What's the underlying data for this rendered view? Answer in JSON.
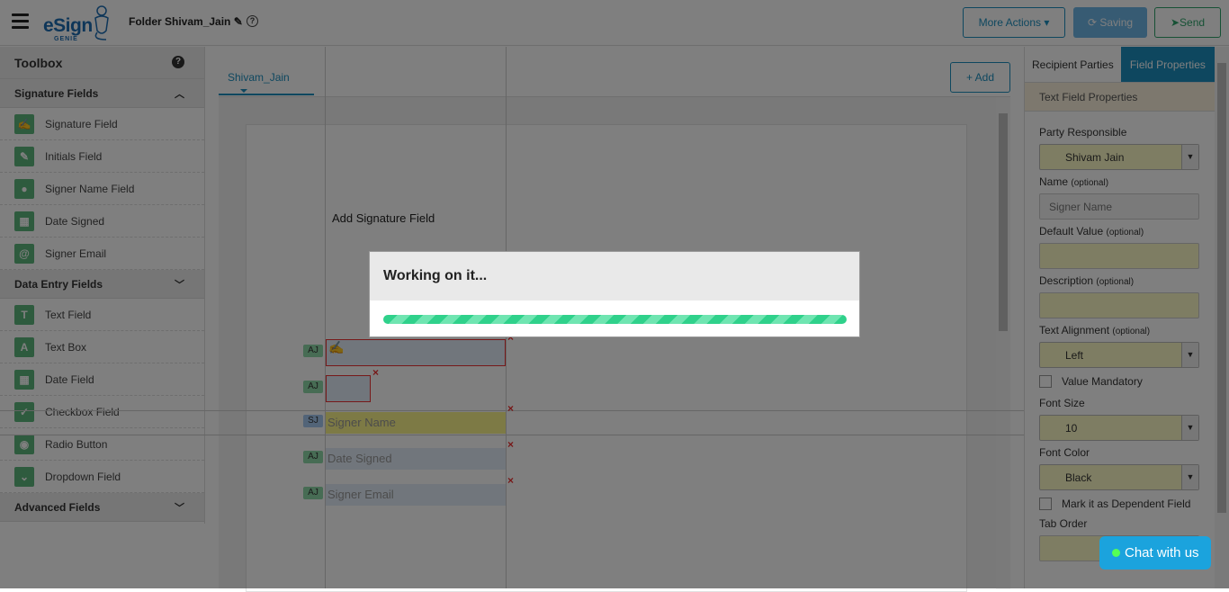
{
  "header": {
    "logo_text": "eSign",
    "logo_sub": "GENIE",
    "folder_title": "Folder Shivam_Jain",
    "more_actions": "More Actions",
    "saving": "Saving",
    "send": "Send"
  },
  "toolbox": {
    "title": "Toolbox",
    "signature_section": "Signature Fields",
    "signature_items": [
      "Signature Field",
      "Initials Field",
      "Signer Name Field",
      "Date Signed",
      "Signer Email"
    ],
    "data_section": "Data Entry Fields",
    "data_items": [
      "Text Field",
      "Text Box",
      "Date Field",
      "Checkbox Field",
      "Radio Button",
      "Dropdown Field"
    ],
    "advanced_section": "Advanced Fields"
  },
  "canvas": {
    "party_tab": "Shivam_Jain",
    "add_button": "Add",
    "page_text": "Add Signature Field",
    "fields": [
      {
        "party": "AJ",
        "text": ""
      },
      {
        "party": "AJ",
        "text": ""
      },
      {
        "party": "SJ",
        "text": "Signer Name"
      },
      {
        "party": "AJ",
        "text": "Date Signed"
      },
      {
        "party": "AJ",
        "text": "Signer Email"
      }
    ]
  },
  "right_panel": {
    "tab_recipients": "Recipient Parties",
    "tab_properties": "Field Properties",
    "subheader": "Text Field Properties",
    "party_label": "Party Responsible",
    "party_value": "Shivam Jain",
    "name_label": "Name",
    "optional": "(optional)",
    "name_placeholder": "Signer Name",
    "default_label": "Default Value",
    "description_label": "Description",
    "alignment_label": "Text Alignment",
    "alignment_value": "Left",
    "mandatory_label": "Value Mandatory",
    "font_size_label": "Font Size",
    "font_size_value": "10",
    "font_color_label": "Font Color",
    "font_color_value": "Black",
    "dependent_label": "Mark it as Dependent Field",
    "tab_order_label": "Tab Order"
  },
  "modal": {
    "title": "Working on it..."
  },
  "chat": {
    "label": "Chat with us"
  }
}
